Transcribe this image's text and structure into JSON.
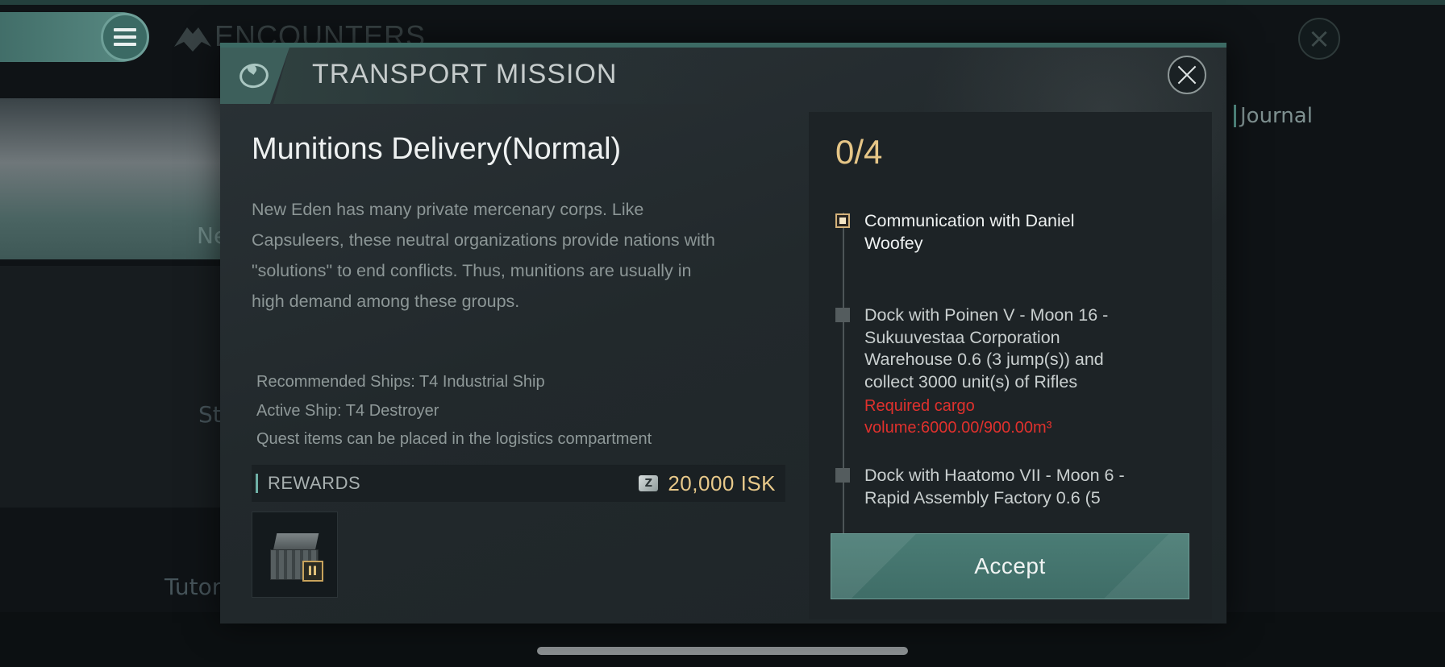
{
  "background": {
    "title": "ENCOUNTERS",
    "journal_label": "Journal",
    "card_label": "Ne",
    "card2_label": "St",
    "tutorial_label": "Tutor"
  },
  "modal": {
    "title": "TRANSPORT MISSION",
    "mission_name": "Munitions Delivery(Normal)",
    "description": "New Eden has many private mercenary corps. Like Capsuleers, these neutral organizations provide nations with \"solutions\" to end conflicts. Thus, munitions are usually in high demand among these groups.",
    "info": {
      "recommended_ships": "Recommended Ships: T4 Industrial Ship",
      "active_ship": "Active Ship: T4 Destroyer",
      "quest_items_note": "Quest items can be placed in the logistics compartment"
    },
    "rewards": {
      "label": "REWARDS",
      "isk_icon": "isk-currency-icon",
      "isk_amount": "20,000 ISK",
      "item_icon": "cargo-crate-icon"
    },
    "progress": {
      "count": "0/4",
      "steps": [
        {
          "text": "Communication with Daniel Woofey",
          "active": true
        },
        {
          "text": "Dock with Poinen V - Moon 16 - Sukuuvestaa Corporation Warehouse 0.6 (3 jump(s)) and collect 3000 unit(s) of Rifles",
          "warning": "Required cargo volume:6000.00/900.00m³"
        },
        {
          "text": "Dock with Haatomo VII - Moon 6 - Rapid Assembly Factory 0.6 (5"
        }
      ]
    },
    "accept_label": "Accept"
  },
  "colors": {
    "accent_teal": "#4a7c75",
    "gold": "#e6c687",
    "warning_red": "#e0312d"
  }
}
